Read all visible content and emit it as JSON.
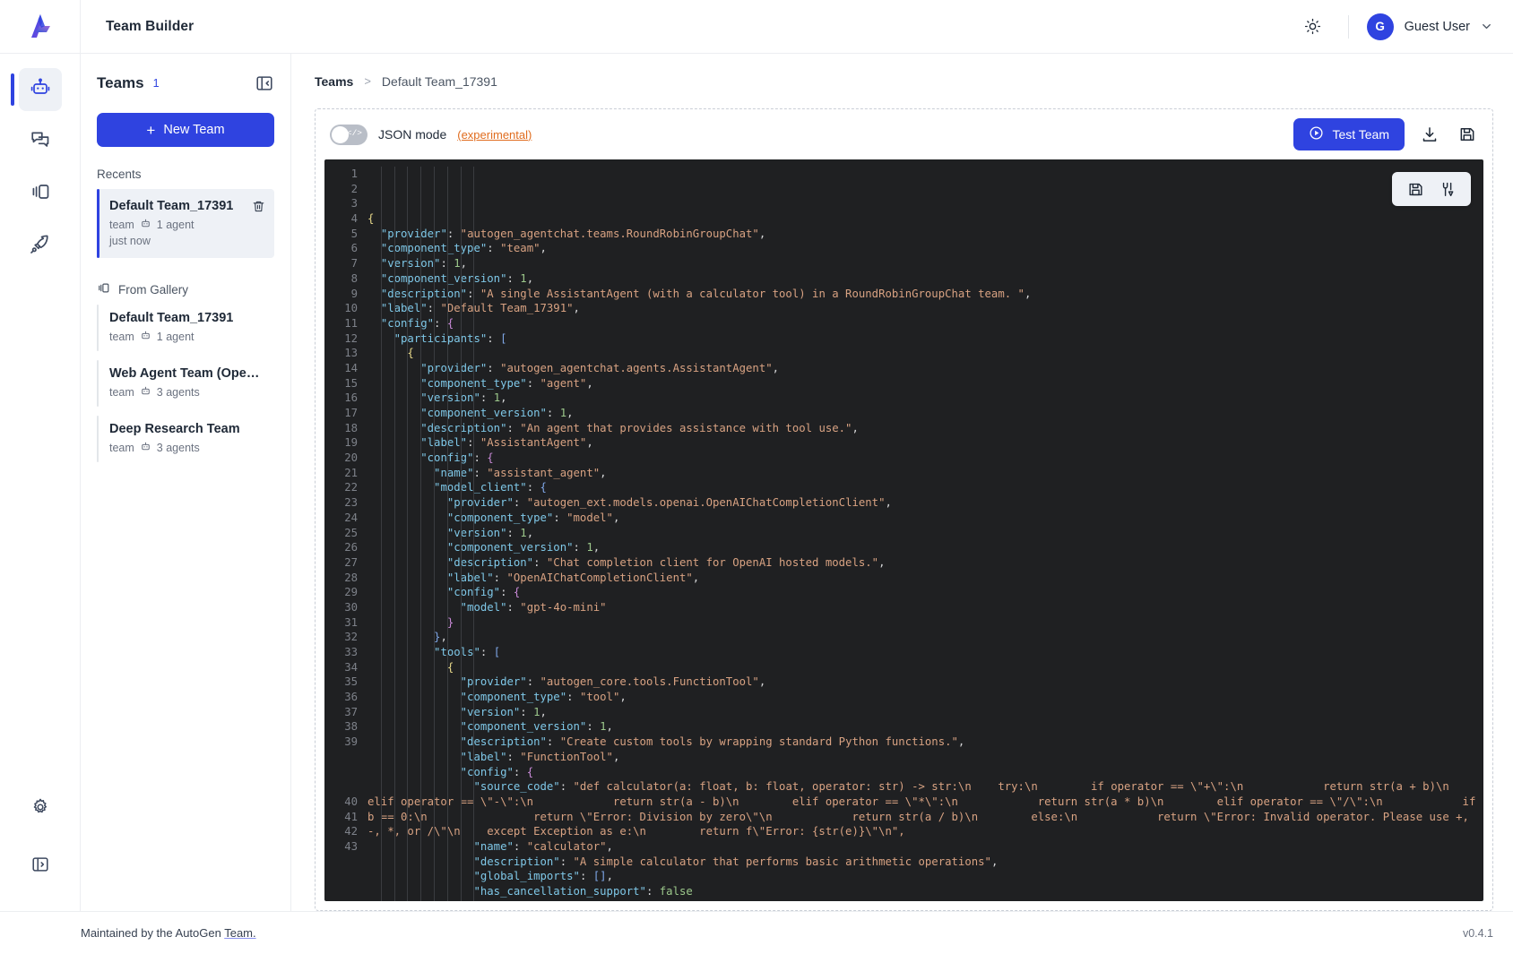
{
  "header": {
    "app_title": "Team Builder",
    "logo_icon": "autogen-logo-icon",
    "theme_icon": "sun-icon",
    "avatar_initial": "G",
    "user_name": "Guest User",
    "caret_icon": "chevron-down-icon"
  },
  "rail": {
    "items": [
      {
        "name": "team-builder",
        "icon": "robot-icon",
        "active": true
      },
      {
        "name": "playground",
        "icon": "chat-bubbles-icon",
        "active": false
      },
      {
        "name": "gallery",
        "icon": "panel-icon",
        "active": false
      },
      {
        "name": "deploy",
        "icon": "rocket-icon",
        "active": false
      }
    ],
    "bottom": [
      {
        "name": "settings",
        "icon": "gear-icon"
      },
      {
        "name": "expand-sidebar",
        "icon": "panel-expand-icon"
      }
    ]
  },
  "teams_panel": {
    "title": "Teams",
    "count": "1",
    "collapse_icon": "panel-collapse-icon",
    "new_team_label": "New Team",
    "recents_label": "Recents",
    "gallery_label": "From Gallery",
    "gallery_icon": "panel-icon",
    "recents": [
      {
        "name": "Default Team_17391",
        "type": "team",
        "agents": "1 agent",
        "time": "just now",
        "selected": true,
        "delete_icon": "trash-icon"
      }
    ],
    "gallery": [
      {
        "name": "Default Team_17391",
        "type": "team",
        "agents": "1 agent"
      },
      {
        "name": "Web Agent Team (Operat...",
        "type": "team",
        "agents": "3 agents"
      },
      {
        "name": "Deep Research Team",
        "type": "team",
        "agents": "3 agents"
      }
    ]
  },
  "breadcrumb": {
    "root": "Teams",
    "separator": ">",
    "current": "Default Team_17391"
  },
  "builder_toolbar": {
    "json_mode_label": "JSON mode",
    "experimental_label": "(experimental)",
    "json_mode_on": false,
    "toggle_glyph": "</>",
    "test_team_label": "Test Team",
    "play_icon": "play-circle-icon",
    "download_icon": "download-icon",
    "save_icon": "save-disk-icon"
  },
  "editor_float_panel": {
    "save_icon": "save-disk-icon",
    "format_icon": "format-tool-icon"
  },
  "footer": {
    "maintained_prefix": "Maintained by the AutoGen ",
    "maintained_link": "Team.",
    "version": "v0.4.1"
  },
  "code": {
    "lines": [
      {
        "num": "1",
        "tokens": [
          {
            "t": "{",
            "c": "b"
          }
        ],
        "indent": 0
      },
      {
        "num": "2",
        "tokens": [
          {
            "t": "\"provider\"",
            "c": "k"
          },
          {
            "t": ": ",
            "c": "p"
          },
          {
            "t": "\"autogen_agentchat.teams.RoundRobinGroupChat\"",
            "c": "s"
          },
          {
            "t": ",",
            "c": "p"
          }
        ],
        "indent": 1
      },
      {
        "num": "3",
        "tokens": [
          {
            "t": "\"component_type\"",
            "c": "k"
          },
          {
            "t": ": ",
            "c": "p"
          },
          {
            "t": "\"team\"",
            "c": "s"
          },
          {
            "t": ",",
            "c": "p"
          }
        ],
        "indent": 1
      },
      {
        "num": "4",
        "tokens": [
          {
            "t": "\"version\"",
            "c": "k"
          },
          {
            "t": ": ",
            "c": "p"
          },
          {
            "t": "1",
            "c": "n"
          },
          {
            "t": ",",
            "c": "p"
          }
        ],
        "indent": 1
      },
      {
        "num": "5",
        "tokens": [
          {
            "t": "\"component_version\"",
            "c": "k"
          },
          {
            "t": ": ",
            "c": "p"
          },
          {
            "t": "1",
            "c": "n"
          },
          {
            "t": ",",
            "c": "p"
          }
        ],
        "indent": 1
      },
      {
        "num": "6",
        "tokens": [
          {
            "t": "\"description\"",
            "c": "k"
          },
          {
            "t": ": ",
            "c": "p"
          },
          {
            "t": "\"A single AssistantAgent (with a calculator tool) in a RoundRobinGroupChat team. \"",
            "c": "s"
          },
          {
            "t": ",",
            "c": "p"
          }
        ],
        "indent": 1
      },
      {
        "num": "7",
        "tokens": [
          {
            "t": "\"label\"",
            "c": "k"
          },
          {
            "t": ": ",
            "c": "p"
          },
          {
            "t": "\"Default Team_17391\"",
            "c": "s"
          },
          {
            "t": ",",
            "c": "p"
          }
        ],
        "indent": 1
      },
      {
        "num": "8",
        "tokens": [
          {
            "t": "\"config\"",
            "c": "k"
          },
          {
            "t": ": ",
            "c": "p"
          },
          {
            "t": "{",
            "c": "br"
          }
        ],
        "indent": 1
      },
      {
        "num": "9",
        "tokens": [
          {
            "t": "\"participants\"",
            "c": "k"
          },
          {
            "t": ": ",
            "c": "p"
          },
          {
            "t": "[",
            "c": "bk"
          }
        ],
        "indent": 2
      },
      {
        "num": "10",
        "tokens": [
          {
            "t": "{",
            "c": "b"
          }
        ],
        "indent": 3
      },
      {
        "num": "11",
        "tokens": [
          {
            "t": "\"provider\"",
            "c": "k"
          },
          {
            "t": ": ",
            "c": "p"
          },
          {
            "t": "\"autogen_agentchat.agents.AssistantAgent\"",
            "c": "s"
          },
          {
            "t": ",",
            "c": "p"
          }
        ],
        "indent": 4
      },
      {
        "num": "12",
        "tokens": [
          {
            "t": "\"component_type\"",
            "c": "k"
          },
          {
            "t": ": ",
            "c": "p"
          },
          {
            "t": "\"agent\"",
            "c": "s"
          },
          {
            "t": ",",
            "c": "p"
          }
        ],
        "indent": 4
      },
      {
        "num": "13",
        "tokens": [
          {
            "t": "\"version\"",
            "c": "k"
          },
          {
            "t": ": ",
            "c": "p"
          },
          {
            "t": "1",
            "c": "n"
          },
          {
            "t": ",",
            "c": "p"
          }
        ],
        "indent": 4
      },
      {
        "num": "14",
        "tokens": [
          {
            "t": "\"component_version\"",
            "c": "k"
          },
          {
            "t": ": ",
            "c": "p"
          },
          {
            "t": "1",
            "c": "n"
          },
          {
            "t": ",",
            "c": "p"
          }
        ],
        "indent": 4
      },
      {
        "num": "15",
        "tokens": [
          {
            "t": "\"description\"",
            "c": "k"
          },
          {
            "t": ": ",
            "c": "p"
          },
          {
            "t": "\"An agent that provides assistance with tool use.\"",
            "c": "s"
          },
          {
            "t": ",",
            "c": "p"
          }
        ],
        "indent": 4
      },
      {
        "num": "16",
        "tokens": [
          {
            "t": "\"label\"",
            "c": "k"
          },
          {
            "t": ": ",
            "c": "p"
          },
          {
            "t": "\"AssistantAgent\"",
            "c": "s"
          },
          {
            "t": ",",
            "c": "p"
          }
        ],
        "indent": 4
      },
      {
        "num": "17",
        "tokens": [
          {
            "t": "\"config\"",
            "c": "k"
          },
          {
            "t": ": ",
            "c": "p"
          },
          {
            "t": "{",
            "c": "br"
          }
        ],
        "indent": 4
      },
      {
        "num": "18",
        "tokens": [
          {
            "t": "\"name\"",
            "c": "k"
          },
          {
            "t": ": ",
            "c": "p"
          },
          {
            "t": "\"assistant_agent\"",
            "c": "s"
          },
          {
            "t": ",",
            "c": "p"
          }
        ],
        "indent": 5
      },
      {
        "num": "19",
        "tokens": [
          {
            "t": "\"model_client\"",
            "c": "k"
          },
          {
            "t": ": ",
            "c": "p"
          },
          {
            "t": "{",
            "c": "bk"
          }
        ],
        "indent": 5
      },
      {
        "num": "20",
        "tokens": [
          {
            "t": "\"provider\"",
            "c": "k"
          },
          {
            "t": ": ",
            "c": "p"
          },
          {
            "t": "\"autogen_ext.models.openai.OpenAIChatCompletionClient\"",
            "c": "s"
          },
          {
            "t": ",",
            "c": "p"
          }
        ],
        "indent": 6
      },
      {
        "num": "21",
        "tokens": [
          {
            "t": "\"component_type\"",
            "c": "k"
          },
          {
            "t": ": ",
            "c": "p"
          },
          {
            "t": "\"model\"",
            "c": "s"
          },
          {
            "t": ",",
            "c": "p"
          }
        ],
        "indent": 6
      },
      {
        "num": "22",
        "tokens": [
          {
            "t": "\"version\"",
            "c": "k"
          },
          {
            "t": ": ",
            "c": "p"
          },
          {
            "t": "1",
            "c": "n"
          },
          {
            "t": ",",
            "c": "p"
          }
        ],
        "indent": 6
      },
      {
        "num": "23",
        "tokens": [
          {
            "t": "\"component_version\"",
            "c": "k"
          },
          {
            "t": ": ",
            "c": "p"
          },
          {
            "t": "1",
            "c": "n"
          },
          {
            "t": ",",
            "c": "p"
          }
        ],
        "indent": 6
      },
      {
        "num": "24",
        "tokens": [
          {
            "t": "\"description\"",
            "c": "k"
          },
          {
            "t": ": ",
            "c": "p"
          },
          {
            "t": "\"Chat completion client for OpenAI hosted models.\"",
            "c": "s"
          },
          {
            "t": ",",
            "c": "p"
          }
        ],
        "indent": 6
      },
      {
        "num": "25",
        "tokens": [
          {
            "t": "\"label\"",
            "c": "k"
          },
          {
            "t": ": ",
            "c": "p"
          },
          {
            "t": "\"OpenAIChatCompletionClient\"",
            "c": "s"
          },
          {
            "t": ",",
            "c": "p"
          }
        ],
        "indent": 6
      },
      {
        "num": "26",
        "tokens": [
          {
            "t": "\"config\"",
            "c": "k"
          },
          {
            "t": ": ",
            "c": "p"
          },
          {
            "t": "{",
            "c": "br"
          }
        ],
        "indent": 6
      },
      {
        "num": "27",
        "tokens": [
          {
            "t": "\"model\"",
            "c": "k"
          },
          {
            "t": ": ",
            "c": "p"
          },
          {
            "t": "\"gpt-4o-mini\"",
            "c": "s"
          }
        ],
        "indent": 7
      },
      {
        "num": "28",
        "tokens": [
          {
            "t": "}",
            "c": "br"
          }
        ],
        "indent": 6
      },
      {
        "num": "29",
        "tokens": [
          {
            "t": "}",
            "c": "bk"
          },
          {
            "t": ",",
            "c": "p"
          }
        ],
        "indent": 5
      },
      {
        "num": "30",
        "tokens": [
          {
            "t": "\"tools\"",
            "c": "k"
          },
          {
            "t": ": ",
            "c": "p"
          },
          {
            "t": "[",
            "c": "bk"
          }
        ],
        "indent": 5
      },
      {
        "num": "31",
        "tokens": [
          {
            "t": "{",
            "c": "b"
          }
        ],
        "indent": 6
      },
      {
        "num": "32",
        "tokens": [
          {
            "t": "\"provider\"",
            "c": "k"
          },
          {
            "t": ": ",
            "c": "p"
          },
          {
            "t": "\"autogen_core.tools.FunctionTool\"",
            "c": "s"
          },
          {
            "t": ",",
            "c": "p"
          }
        ],
        "indent": 7
      },
      {
        "num": "33",
        "tokens": [
          {
            "t": "\"component_type\"",
            "c": "k"
          },
          {
            "t": ": ",
            "c": "p"
          },
          {
            "t": "\"tool\"",
            "c": "s"
          },
          {
            "t": ",",
            "c": "p"
          }
        ],
        "indent": 7
      },
      {
        "num": "34",
        "tokens": [
          {
            "t": "\"version\"",
            "c": "k"
          },
          {
            "t": ": ",
            "c": "p"
          },
          {
            "t": "1",
            "c": "n"
          },
          {
            "t": ",",
            "c": "p"
          }
        ],
        "indent": 7
      },
      {
        "num": "35",
        "tokens": [
          {
            "t": "\"component_version\"",
            "c": "k"
          },
          {
            "t": ": ",
            "c": "p"
          },
          {
            "t": "1",
            "c": "n"
          },
          {
            "t": ",",
            "c": "p"
          }
        ],
        "indent": 7
      },
      {
        "num": "36",
        "tokens": [
          {
            "t": "\"description\"",
            "c": "k"
          },
          {
            "t": ": ",
            "c": "p"
          },
          {
            "t": "\"Create custom tools by wrapping standard Python functions.\"",
            "c": "s"
          },
          {
            "t": ",",
            "c": "p"
          }
        ],
        "indent": 7
      },
      {
        "num": "37",
        "tokens": [
          {
            "t": "\"label\"",
            "c": "k"
          },
          {
            "t": ": ",
            "c": "p"
          },
          {
            "t": "\"FunctionTool\"",
            "c": "s"
          },
          {
            "t": ",",
            "c": "p"
          }
        ],
        "indent": 7
      },
      {
        "num": "38",
        "tokens": [
          {
            "t": "\"config\"",
            "c": "k"
          },
          {
            "t": ": ",
            "c": "p"
          },
          {
            "t": "{",
            "c": "br"
          }
        ],
        "indent": 7
      },
      {
        "num": "39",
        "wrapped": true,
        "indent": 8,
        "tokens": [
          {
            "t": "\"source_code\"",
            "c": "k"
          },
          {
            "t": ": ",
            "c": "p"
          },
          {
            "t": "\"def calculator(a: float, b: float, operator: str) -> str:\\n    try:\\n        if operator == \\\"+\\\":\\n            return str(a + b)\\n        elif operator == \\\"-\\\":\\n            return str(a - b)\\n        elif operator == \\\"*\\\":\\n            return str(a * b)\\n        elif operator == \\\"/\\\":\\n            if b == 0:\\n                return \\\"Error: Division by zero\\\"\\n            return str(a / b)\\n        else:\\n            return \\\"Error: Invalid operator. Please use +, -, *, or /\\\"\\n    except Exception as e:\\n        return f\\\"Error: {str(e)}\\\"\\n\",",
            "c": "s"
          }
        ]
      },
      {
        "num": "40",
        "tokens": [
          {
            "t": "\"name\"",
            "c": "k"
          },
          {
            "t": ": ",
            "c": "p"
          },
          {
            "t": "\"calculator\"",
            "c": "s"
          },
          {
            "t": ",",
            "c": "p"
          }
        ],
        "indent": 8
      },
      {
        "num": "41",
        "tokens": [
          {
            "t": "\"description\"",
            "c": "k"
          },
          {
            "t": ": ",
            "c": "p"
          },
          {
            "t": "\"A simple calculator that performs basic arithmetic operations\"",
            "c": "s"
          },
          {
            "t": ",",
            "c": "p"
          }
        ],
        "indent": 8
      },
      {
        "num": "42",
        "tokens": [
          {
            "t": "\"global_imports\"",
            "c": "k"
          },
          {
            "t": ": ",
            "c": "p"
          },
          {
            "t": "[]",
            "c": "bk"
          },
          {
            "t": ",",
            "c": "p"
          }
        ],
        "indent": 8
      },
      {
        "num": "43",
        "tokens": [
          {
            "t": "\"has_cancellation_support\"",
            "c": "k"
          },
          {
            "t": ": ",
            "c": "p"
          },
          {
            "t": "false",
            "c": "n"
          }
        ],
        "indent": 8
      }
    ]
  }
}
